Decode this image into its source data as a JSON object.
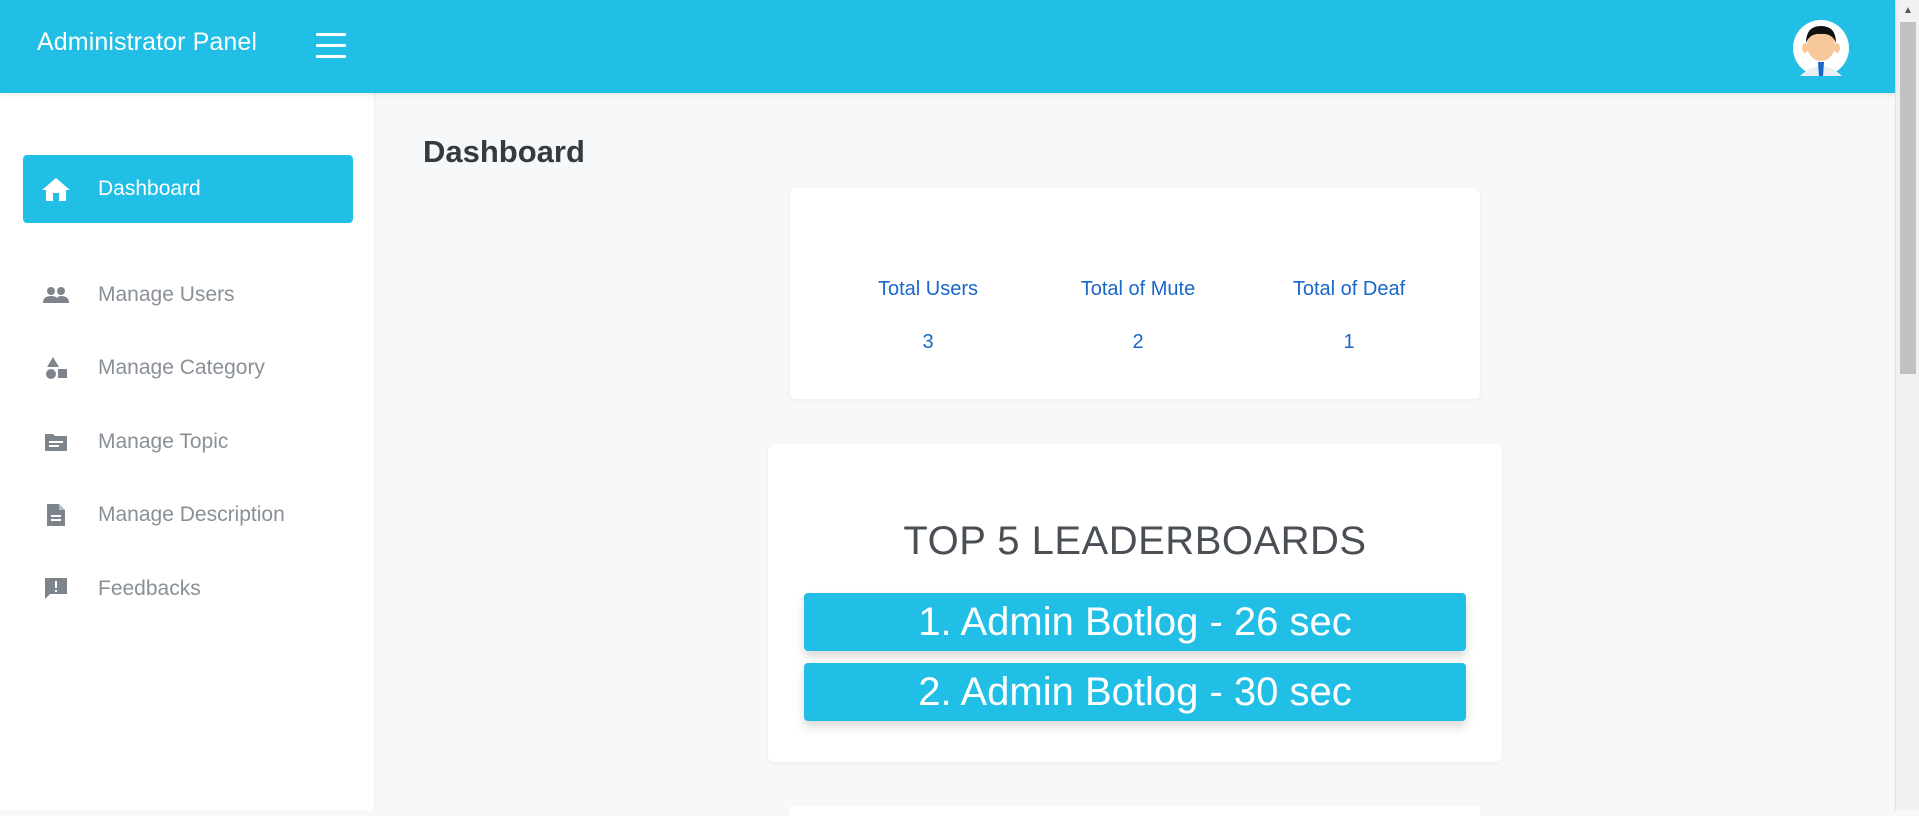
{
  "header": {
    "title": "Administrator Panel",
    "menu_icon": "hamburger-icon",
    "avatar_icon": "user-avatar-icon",
    "brand_color": "#21bfe5"
  },
  "sidebar": {
    "items": [
      {
        "label": "Dashboard",
        "icon": "home-icon",
        "active": true
      },
      {
        "label": "Manage Users",
        "icon": "users-icon",
        "active": false
      },
      {
        "label": "Manage Category",
        "icon": "shapes-icon",
        "active": false
      },
      {
        "label": "Manage Topic",
        "icon": "folder-icon",
        "active": false
      },
      {
        "label": "Manage Description",
        "icon": "document-icon",
        "active": false
      },
      {
        "label": "Feedbacks",
        "icon": "feedback-icon",
        "active": false
      }
    ]
  },
  "main": {
    "page_title": "Dashboard",
    "stats": [
      {
        "label": "Total Users",
        "value": "3"
      },
      {
        "label": "Total of Mute",
        "value": "2"
      },
      {
        "label": "Total of Deaf",
        "value": "1"
      }
    ],
    "leaderboard": {
      "title": "TOP 5 LEADERBOARDS",
      "entries": [
        "1. Admin Botlog - 26 sec",
        "2. Admin Botlog - 30 sec"
      ]
    }
  }
}
